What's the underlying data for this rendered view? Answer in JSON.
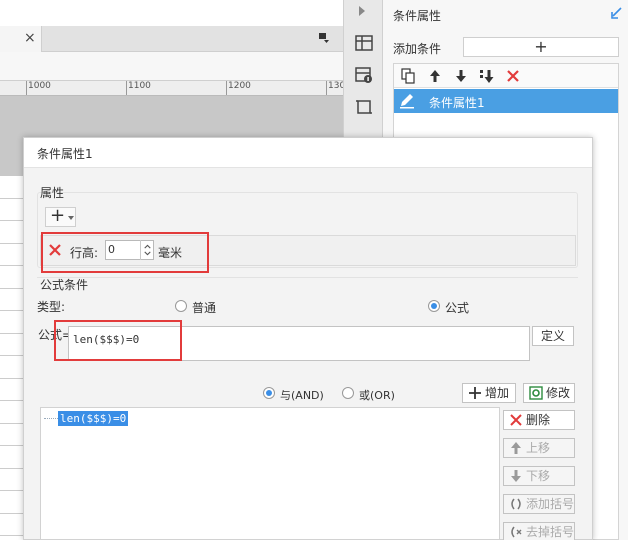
{
  "right_panel": {
    "title": "条件属性",
    "add_condition_label": "添加条件",
    "add_button_label": "+",
    "selected_item": "条件属性1"
  },
  "ruler": {
    "labels": [
      "1000",
      "1100",
      "1200",
      "130"
    ]
  },
  "dialog": {
    "title": "条件属性1",
    "attributes": {
      "section_label": "属性",
      "add_label": "+",
      "row": {
        "name": "行高:",
        "value": "0",
        "unit": "毫米"
      }
    },
    "formula_condition": {
      "section_label": "公式条件",
      "type_label": "类型:",
      "type_options": [
        "普通",
        "公式"
      ],
      "selected_type": "公式",
      "formula_label": "公式=",
      "formula_value": "len($$$)=0",
      "define_button": "定义",
      "logic_options": [
        "与(AND)",
        "或(OR)"
      ],
      "selected_logic": "与(AND)",
      "add_button": "增加",
      "modify_button": "修改",
      "conditions": [
        "len($$$)=0"
      ],
      "side_buttons": [
        "删除",
        "上移",
        "下移",
        "添加括号",
        "去掉括号"
      ]
    }
  },
  "colors": {
    "accent": "#3a8ee6",
    "selected_bg": "#4a9fe3",
    "highlight_red": "#e23b3b",
    "delete_red": "#e23b3b"
  }
}
